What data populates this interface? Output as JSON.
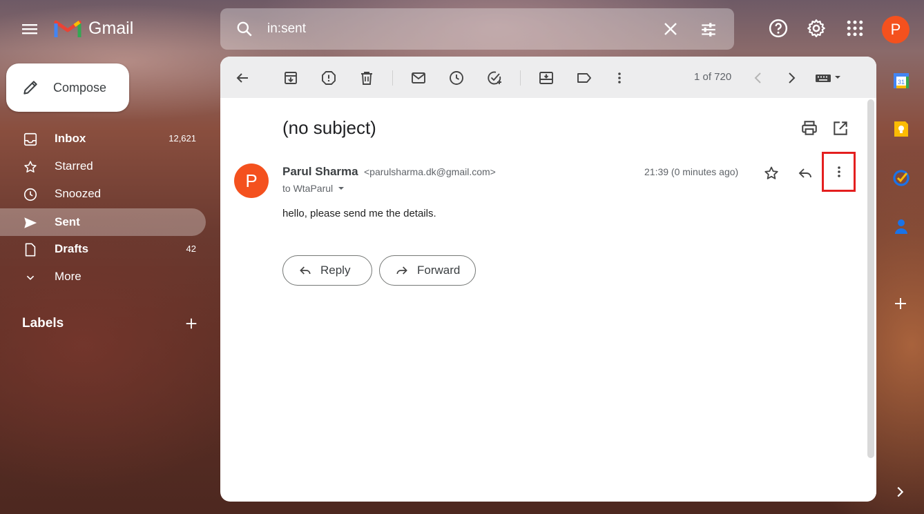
{
  "app": {
    "name": "Gmail",
    "brand_color": "#EA4335"
  },
  "search": {
    "value": "in:sent"
  },
  "account": {
    "initial": "P",
    "color": "#F4511E"
  },
  "compose": {
    "label": "Compose"
  },
  "nav": [
    {
      "label": "Inbox",
      "count": "12,621",
      "bold": true,
      "icon": "inbox-icon"
    },
    {
      "label": "Starred",
      "count": "",
      "bold": false,
      "icon": "star-icon"
    },
    {
      "label": "Snoozed",
      "count": "",
      "bold": false,
      "icon": "clock-icon"
    },
    {
      "label": "Sent",
      "count": "",
      "bold": true,
      "active": true,
      "icon": "send-icon"
    },
    {
      "label": "Drafts",
      "count": "42",
      "bold": true,
      "icon": "draft-icon"
    },
    {
      "label": "More",
      "count": "",
      "bold": false,
      "icon": "chevron-down-icon"
    }
  ],
  "labels": {
    "heading": "Labels"
  },
  "toolbar": {
    "pager": "1 of 720"
  },
  "message": {
    "subject": "(no subject)",
    "sender_initial": "P",
    "sender_name": "Parul Sharma",
    "sender_email": "<parulsharma.dk@gmail.com>",
    "recipient": "to WtaParul",
    "timestamp": "21:39 (0 minutes ago)",
    "body": "hello, please send me the details."
  },
  "actions": {
    "reply": "Reply",
    "forward": "Forward"
  },
  "side_apps": [
    "calendar-icon",
    "keep-icon",
    "tasks-icon",
    "contacts-icon"
  ],
  "highlight_color": "#E41F1F"
}
